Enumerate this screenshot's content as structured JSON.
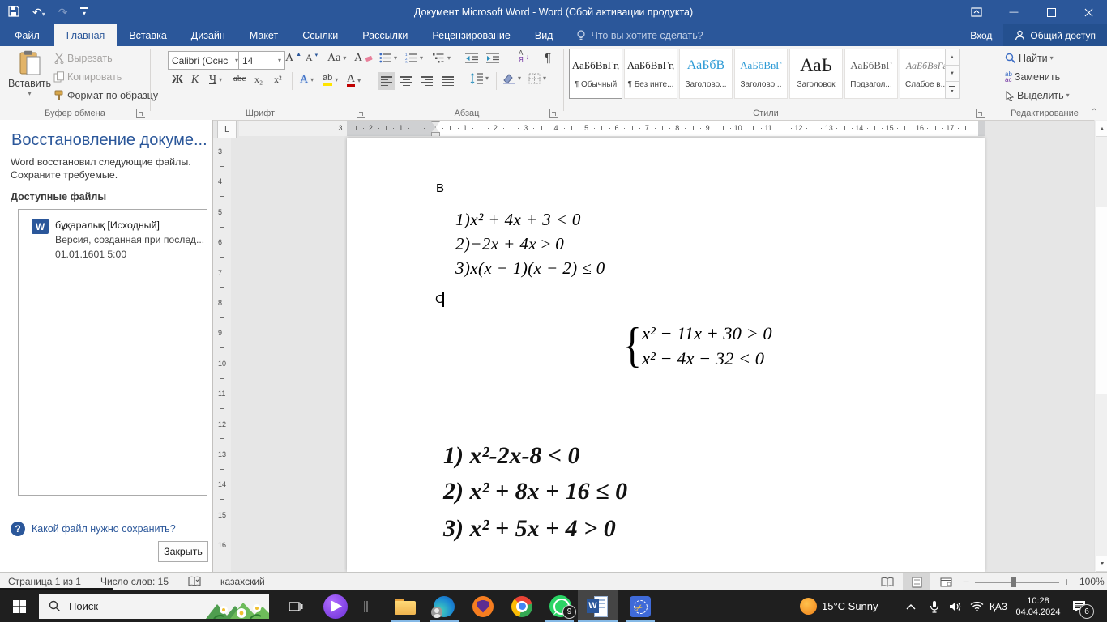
{
  "title_bar": {
    "title": "Документ Microsoft Word - Word (Сбой активации продукта)"
  },
  "tabs": [
    {
      "label": "Файл"
    },
    {
      "label": "Главная"
    },
    {
      "label": "Вставка"
    },
    {
      "label": "Дизайн"
    },
    {
      "label": "Макет"
    },
    {
      "label": "Ссылки"
    },
    {
      "label": "Рассылки"
    },
    {
      "label": "Рецензирование"
    },
    {
      "label": "Вид"
    }
  ],
  "tell_me": "Что вы хотите сделать?",
  "account": {
    "sign_in": "Вход",
    "share": "Общий доступ"
  },
  "ribbon": {
    "clipboard": {
      "paste": "Вставить",
      "cut": "Вырезать",
      "copy": "Копировать",
      "format_painter": "Формат по образцу",
      "label": "Буфер обмена"
    },
    "font": {
      "family": "Calibri (Оснс",
      "size": "14",
      "bold": "Ж",
      "italic": "К",
      "underline": "Ч",
      "strike": "abc",
      "subscript": "x₂",
      "superscript": "x²",
      "case_btn": "Aa",
      "effects": "А",
      "highlight": "ab",
      "color_btn": "А",
      "grow": "А",
      "shrink": "А",
      "label": "Шрифт"
    },
    "paragraph": {
      "sort_a": "А",
      "sort_b": "Я",
      "pilcrow": "¶",
      "label": "Абзац"
    },
    "styles": {
      "label": "Стили",
      "items": [
        {
          "preview": "АаБбВвГг,",
          "name": "¶ Обычный"
        },
        {
          "preview": "АаБбВвГг,",
          "name": "¶ Без инте..."
        },
        {
          "preview": "АаБбВ",
          "name": "Заголово..."
        },
        {
          "preview": "АаБбВвГ",
          "name": "Заголово..."
        },
        {
          "preview": "АаЬ",
          "name": "Заголовок"
        },
        {
          "preview": "АаБбВвГ",
          "name": "Подзагол..."
        },
        {
          "preview": "АаБбВвГг",
          "name": "Слабое в..."
        }
      ]
    },
    "editing": {
      "find": "Найти",
      "replace": "Заменить",
      "select": "Выделить",
      "label": "Редактирование"
    }
  },
  "recovery_panel": {
    "title": "Восстановление докуме...",
    "description": "Word восстановил следующие файлы. Сохраните требуемые.",
    "files_heading": "Доступные файлы",
    "file": {
      "icon": "W",
      "name": "бұқаралық [Исходный]",
      "version": "Версия, созданная при послед...",
      "date": "01.01.1601 5:00"
    },
    "help_link": "Какой файл нужно сохранить?",
    "close_button": "Закрыть"
  },
  "document": {
    "section_b": "B",
    "equations": [
      "1)x² + 4x + 3 < 0",
      "2)−2x + 4x ≥ 0",
      "3)x(x − 1)(x − 2) ≤ 0"
    ],
    "section_c": "C",
    "system_brace": "{",
    "system": [
      "x² − 11x + 30 > 0",
      "x² − 4x − 32 < 0"
    ],
    "image_equations": [
      "1) x²-2x-8 < 0",
      "2) x² + 8x + 16 ≤ 0",
      "3) x² + 5x + 4 > 0"
    ]
  },
  "rulers": {
    "tab_selector": "L",
    "h_margin": [
      "3",
      "2",
      "1"
    ],
    "h_content": [
      "1",
      "2",
      "3",
      "4",
      "5",
      "6",
      "7",
      "8",
      "9",
      "10",
      "11",
      "12",
      "13",
      "14",
      "15",
      "16",
      "17"
    ],
    "v_numbers": [
      "3",
      "4",
      "5",
      "6",
      "7",
      "8",
      "9",
      "10",
      "11",
      "12",
      "13",
      "14",
      "15",
      "16"
    ]
  },
  "status_bar": {
    "page": "Страница 1 из 1",
    "words": "Число слов: 15",
    "language": "казахский",
    "zoom": "100%"
  },
  "taskbar": {
    "search_placeholder": "Поиск",
    "whatsapp_badge": "9",
    "weather": "15°C Sunny",
    "language": "ҚАЗ",
    "time": "10:28",
    "date": "04.04.2024",
    "notification_badge": "6"
  },
  "icons": {
    "caret": "▾",
    "undo": "↶",
    "redo": "↷",
    "minimize": "—",
    "up": "▲",
    "down": "▼",
    "minus": "−",
    "plus": "+",
    "collapse": "⌃",
    "help": "?"
  }
}
